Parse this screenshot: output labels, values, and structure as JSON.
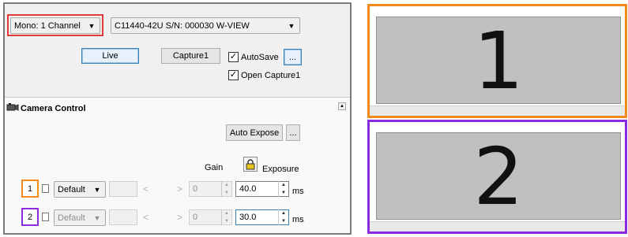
{
  "top": {
    "mode_select": "Mono: 1 Channel",
    "camera_select": "C11440-42U S/N: 000030 W-VIEW",
    "live_button": "Live",
    "capture_button": "Capture1",
    "autosave_label": "AutoSave",
    "autosave_checked": true,
    "more_button": "...",
    "open_capture_label": "Open Capture1",
    "open_capture_checked": true
  },
  "camera_control": {
    "title": "Camera Control",
    "auto_expose_button": "Auto Expose",
    "more_button": "...",
    "gain_header": "Gain",
    "exposure_header": "Exposure",
    "rows": [
      {
        "index": "1",
        "preset": "Default",
        "gain": "0",
        "exposure": "40.0",
        "unit": "ms",
        "highlight": "#f28a1d"
      },
      {
        "index": "2",
        "preset": "Default",
        "gain": "0",
        "exposure": "30.0",
        "unit": "ms",
        "highlight": "#8a2be2"
      }
    ]
  },
  "views": [
    {
      "label": "1",
      "border_color": "#f28a1d"
    },
    {
      "label": "2",
      "border_color": "#8a2be2"
    }
  ],
  "colors": {
    "mode_highlight": "#e23a3a",
    "panel_border": "#7a7a7a"
  },
  "icons": {
    "collapse": "collapse-up-icon",
    "camera": "camera-icon",
    "lock": "padlock-icon"
  }
}
